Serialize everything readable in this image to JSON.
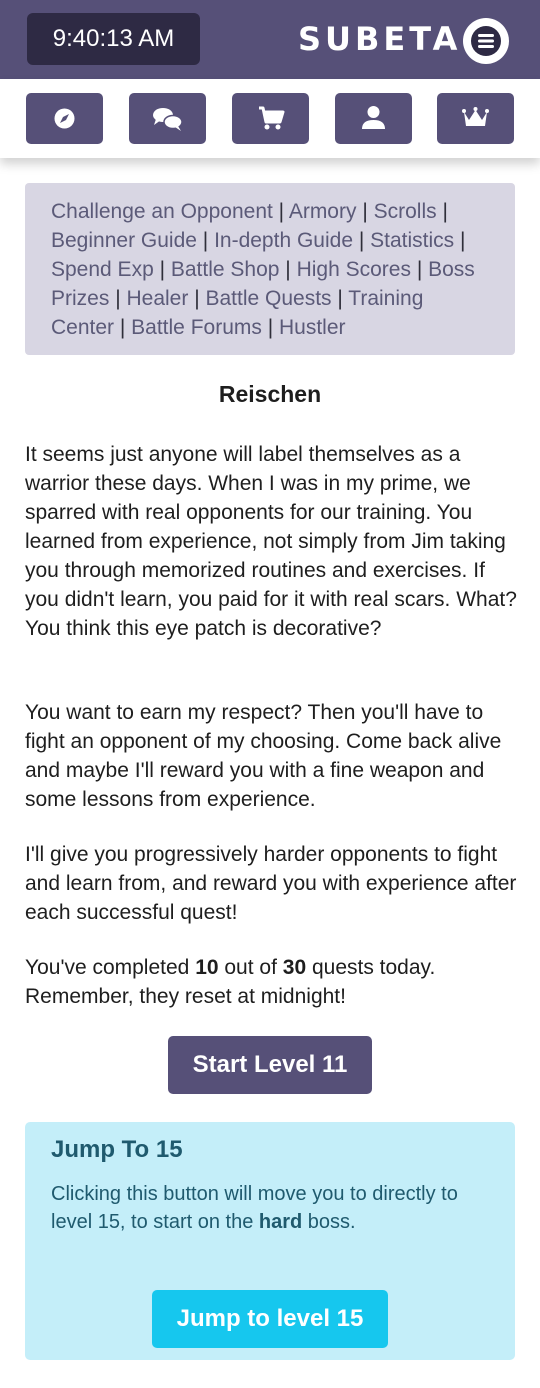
{
  "header": {
    "clock": "9:40:13 AM",
    "brand": "SUBETA",
    "menu_icon": "hamburger-menu-icon",
    "bar_color": "#565078"
  },
  "nav": {
    "buttons": [
      {
        "icon": "compass-icon",
        "name": "explore"
      },
      {
        "icon": "chat-bubbles-icon",
        "name": "forums"
      },
      {
        "icon": "shopping-cart-icon",
        "name": "shops"
      },
      {
        "icon": "user-icon",
        "name": "profile"
      },
      {
        "icon": "crown-icon",
        "name": "premium"
      }
    ]
  },
  "links": [
    "Challenge an Opponent",
    "Armory",
    "Scrolls",
    "Beginner Guide",
    "In-depth Guide",
    "Statistics",
    "Spend Exp",
    "Battle Shop",
    "High Scores",
    "Boss Prizes",
    "Healer",
    "Battle Quests",
    "Training Center",
    "Battle Forums",
    "Hustler"
  ],
  "main": {
    "title": "Reischen",
    "paragraph1": "It seems just anyone will label themselves as a warrior these days. When I was in my prime, we sparred with real opponents for our training. You learned from experience, not simply from Jim taking you through memorized routines and exercises. If you didn't learn, you paid for it with real scars. What? You think this eye patch is decorative?",
    "paragraph2": "You want to earn my respect? Then you'll have to fight an opponent of my choosing. Come back alive and maybe I'll reward you with a fine weapon and some lessons from experience.",
    "paragraph3": "I'll give you progressively harder opponents to fight and learn from, and reward you with experience after each successful quest!",
    "progress": {
      "prefix": "You've completed ",
      "completed": "10",
      "middle": " out of ",
      "total": "30",
      "suffix": " quests today. Remember, they reset at midnight!"
    },
    "start_button": "Start Level 11"
  },
  "jump": {
    "title": "Jump To 15",
    "text_prefix": "Clicking this button will move you to directly to level 15, to start on the ",
    "text_bold": "hard",
    "text_suffix": " boss.",
    "button": "Jump to level 15",
    "box_color": "#c4eef9",
    "button_color": "#16c7ee"
  }
}
